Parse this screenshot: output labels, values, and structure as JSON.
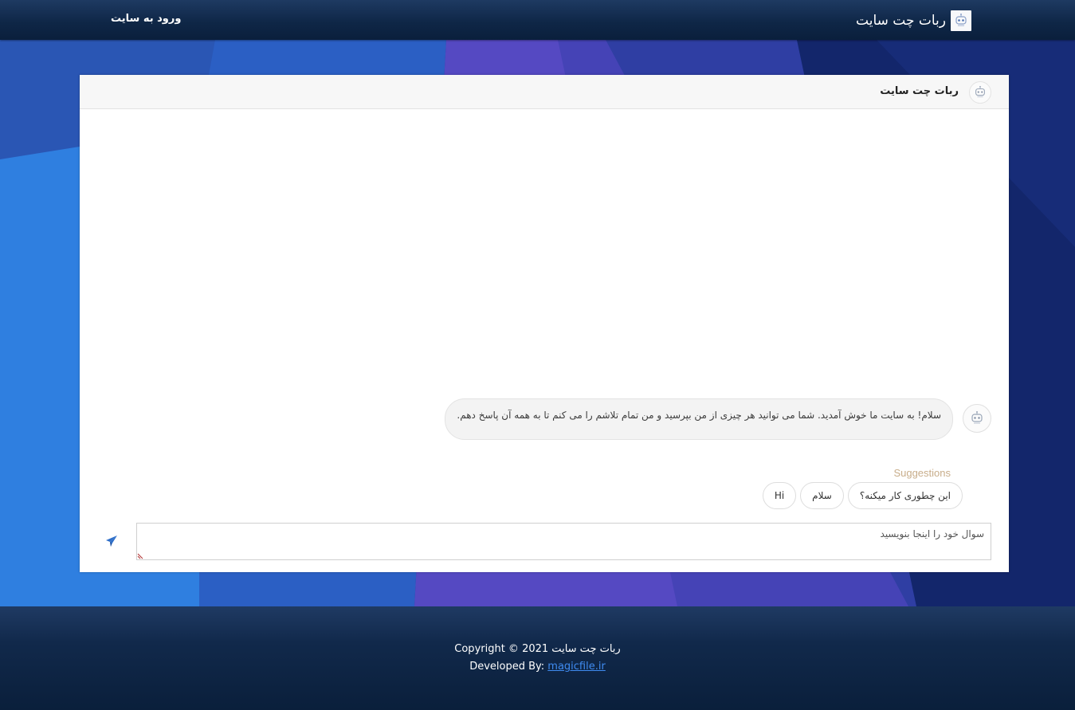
{
  "navbar": {
    "brand_title": "ربات چت سایت",
    "brand_icon": "robot-icon",
    "login_label": "ورود به سایت"
  },
  "chat": {
    "header_title": "ربات چت سایت",
    "header_icon": "robot-icon",
    "messages": [
      {
        "sender": "bot",
        "text": "سلام! به سایت ما خوش آمدید. شما می توانید هر چیزی از من بپرسید و من تمام تلاشم را می کنم تا به همه آن پاسخ دهم."
      }
    ],
    "suggestions_label": "Suggestions",
    "suggestions": [
      "این چطوری کار میکنه؟",
      "سلام",
      "Hi"
    ],
    "input_placeholder": "سوال خود را اینجا بنویسید",
    "send_icon": "paper-plane-icon"
  },
  "footer": {
    "copyright": "Copyright © ربات چت سایت 2021",
    "developed_by_label": "Developed By:",
    "developed_by_link": "magicfile.ir"
  },
  "colors": {
    "navbar": "#0f2747",
    "hero_blue": "#2f7fe0",
    "hero_purple": "#5b4bc4",
    "hero_dark": "#13266b",
    "accent_link": "#3f8bf0",
    "send_icon": "#2f6fc9",
    "suggestions_label": "#c8ad8a"
  }
}
